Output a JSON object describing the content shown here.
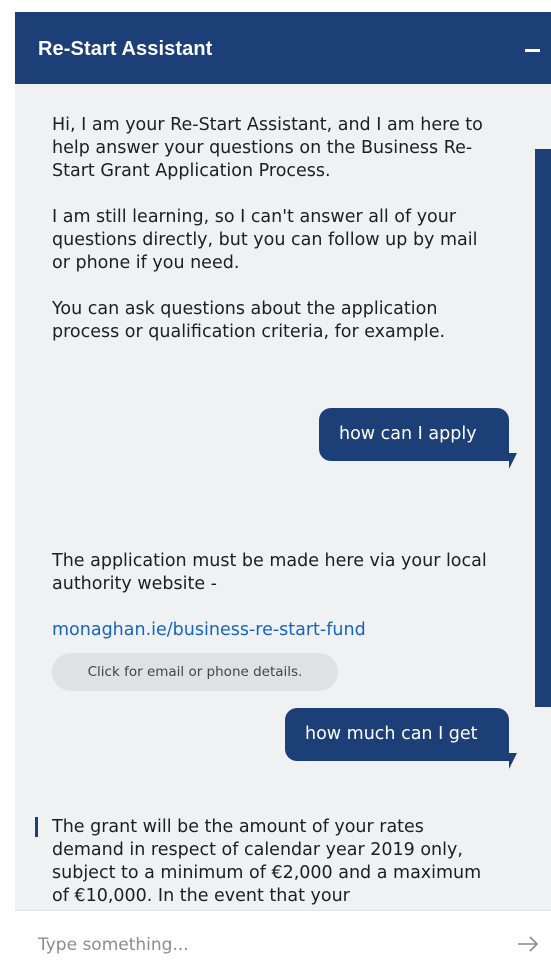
{
  "header": {
    "title": "Re-Start Assistant"
  },
  "messages": {
    "bot_intro": "Hi, I am your Re-Start Assistant, and I am here to help answer your questions on the Business Re-Start Grant Application Process.\n\nI am still learning, so I can't answer all of your questions directly, but you can follow up by mail or phone if you need.\n\nYou can ask questions about the application process or qualification criteria, for example.",
    "user_1": "how can I apply",
    "bot_apply_text": "The application must be made here via your local authority website -",
    "bot_apply_link": "monaghan.ie/business-re-start-fund",
    "contact_chip": "Click for email or phone details.",
    "user_2": "how much can I get",
    "bot_grant": "The grant will be the amount of your rates demand in respect of calendar year 2019 only, subject to a minimum of €2,000 and a maximum of €10,000. In the event that your"
  },
  "input": {
    "placeholder": "Type something..."
  },
  "colors": {
    "brand": "#1c3f78",
    "link": "#1565c0",
    "chat_bg": "#f0f1f3"
  },
  "icons": {
    "minimize": "minus-icon",
    "send": "arrow-right-icon"
  }
}
